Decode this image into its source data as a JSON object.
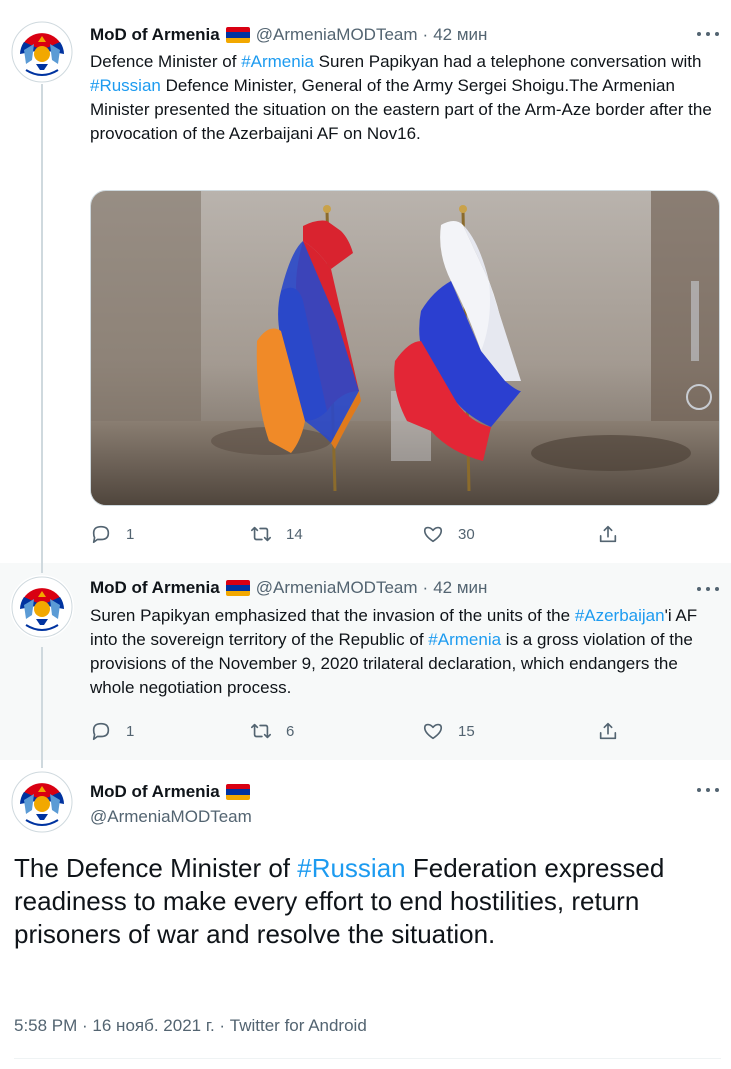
{
  "colors": {
    "accent": "#1d9bf0",
    "muted": "#536471",
    "text": "#0f1419"
  },
  "flag_armenia": [
    "#d90012",
    "#0033a0",
    "#f2a800"
  ],
  "tweets": [
    {
      "name": "MoD of Armenia",
      "handle": "@ArmeniaMODTeam",
      "separator": "·",
      "time": "42 мин",
      "text_parts": [
        "Defence Minister of ",
        "#Armenia",
        " Suren Papikyan had a telephone conversation with ",
        "#Russian",
        " Defence Minister, General of the Army Sergei Shoigu.The Armenian Minister presented the situation on the eastern part of the Arm-Aze border after the provocation of the Azerbaijani AF on Nov16."
      ],
      "media_icon": "armenia-russia-flags-photo",
      "replies": "1",
      "retweets": "14",
      "likes": "30"
    },
    {
      "name": "MoD of Armenia",
      "handle": "@ArmeniaMODTeam",
      "separator": "·",
      "time": "42 мин",
      "text_parts": [
        "Suren Papikyan emphasized that the invasion of the units of the ",
        "#Azerbaijan",
        "'i AF into the sovereign territory of the Republic of ",
        "#Armenia",
        " is a gross violation of the provisions of the November 9, 2020 trilateral declaration, which endangers the whole negotiation process."
      ],
      "replies": "1",
      "retweets": "6",
      "likes": "15"
    }
  ],
  "main_tweet": {
    "name": "MoD of Armenia",
    "handle": "@ArmeniaMODTeam",
    "text_parts": [
      "The Defence Minister of ",
      "#Russian",
      " Federation expressed readiness to make every effort to end hostilities, return prisoners of war and resolve the situation."
    ],
    "meta": "5:58 PM · 16 нояб. 2021 г. · Twitter for Android"
  }
}
